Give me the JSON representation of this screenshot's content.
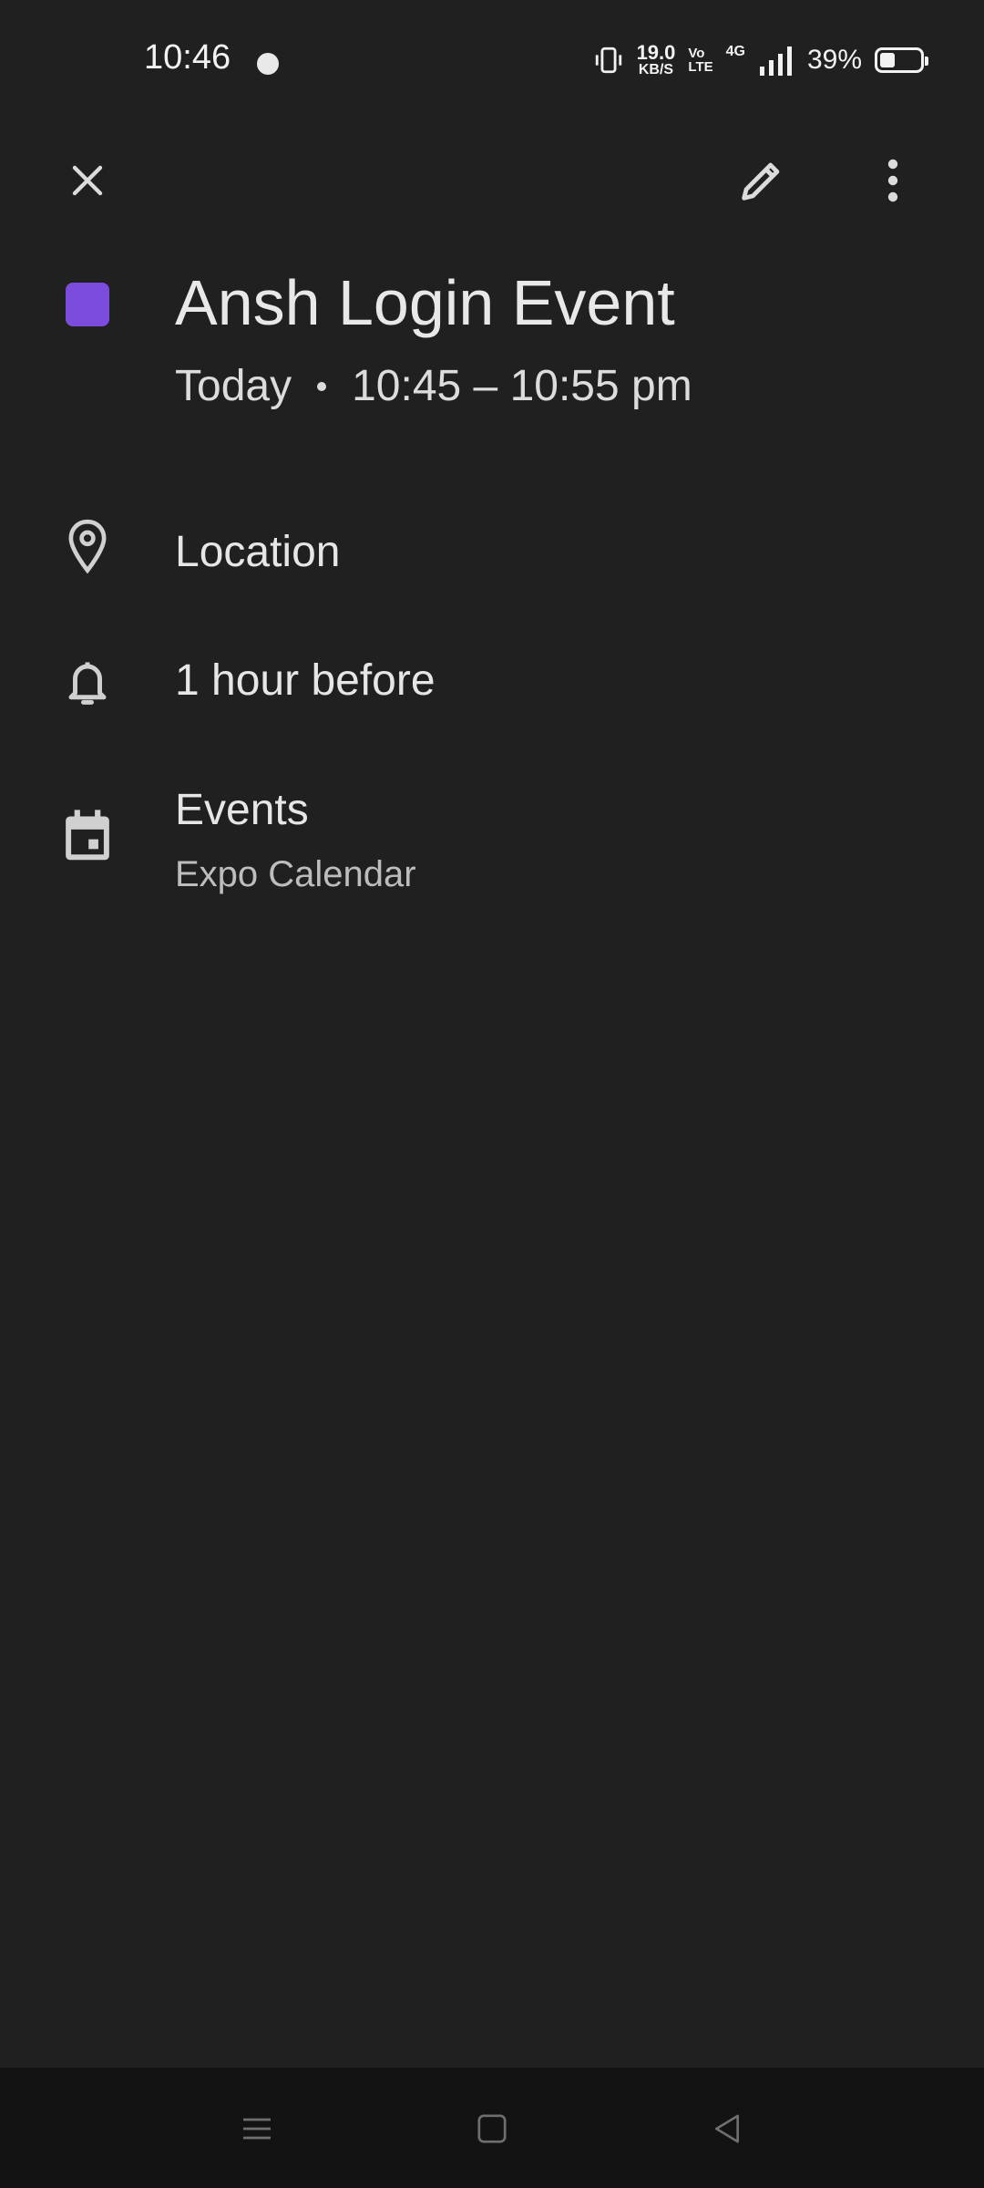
{
  "status_bar": {
    "time": "10:46",
    "net_speed_value": "19.0",
    "net_speed_unit": "KB/S",
    "volte_top": "Vo",
    "volte_bottom": "LTE",
    "network": "4G",
    "battery_percent": "39%",
    "battery_level": 0.39
  },
  "toolbar": {
    "close_icon": "close-icon",
    "edit_icon": "pencil-icon",
    "more_icon": "more-vert-icon"
  },
  "event": {
    "title": "Ansh Login Event",
    "color": "#7c4ddd",
    "day": "Today",
    "time_range": "10:45 – 10:55 pm",
    "location": "Location",
    "reminder": "1 hour before",
    "calendar_name": "Events",
    "calendar_account": "Expo Calendar"
  },
  "nav_bar": {
    "menu_icon": "menu-icon",
    "home_icon": "home-square-icon",
    "back_icon": "back-triangle-icon"
  }
}
